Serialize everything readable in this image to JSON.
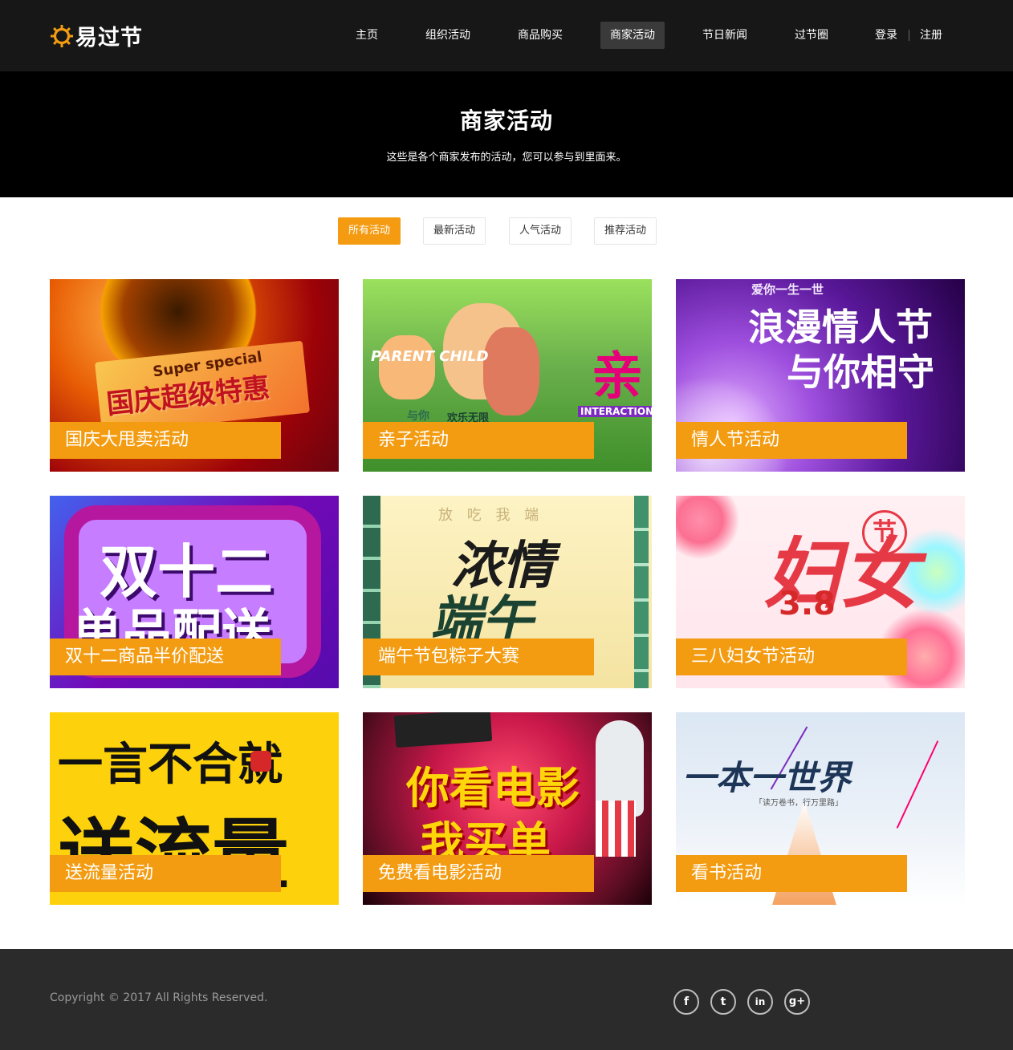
{
  "brand": {
    "name": "易过节",
    "accent": "#f39c12"
  },
  "nav": {
    "items": [
      "主页",
      "组织活动",
      "商品购买",
      "商家活动",
      "节日新闻",
      "过节圈"
    ],
    "active_index": 3,
    "login": "登录",
    "register": "注册"
  },
  "hero": {
    "title": "商家活动",
    "subtitle": "这些是各个商家发布的活动，您可以参与到里面来。"
  },
  "filters": {
    "items": [
      "所有活动",
      "最新活动",
      "人气活动",
      "推荐活动"
    ],
    "active_index": 0
  },
  "cards": [
    {
      "label": "国庆大甩卖活动",
      "art": [
        "Super special",
        "国庆超级特惠"
      ]
    },
    {
      "label": "亲子活动",
      "art": [
        "PARENT CHILD",
        "亲",
        "与你",
        "欢乐无限",
        "INTERACTION"
      ]
    },
    {
      "label": "情人节活动",
      "art": [
        "爱你一生一世",
        "浪漫情人节",
        "与你相守"
      ]
    },
    {
      "label": "双十二商品半价配送",
      "art": [
        "双十二",
        "单品配送"
      ]
    },
    {
      "label": "端午节包粽子大赛",
      "art": [
        "浓情",
        "端午",
        "放 吃 我 端"
      ]
    },
    {
      "label": "三八妇女节活动",
      "art": [
        "妇女",
        "节",
        "3.8"
      ]
    },
    {
      "label": "送流量活动",
      "art": [
        "一言不合就",
        "送流量"
      ]
    },
    {
      "label": "免费看电影活动",
      "art": [
        "你看电影",
        "我买单"
      ]
    },
    {
      "label": "看书活动",
      "art": [
        "一本一世界",
        "「读万卷书，行万里路」"
      ]
    }
  ],
  "footer": {
    "copyright": "Copyright © 2017 All Rights Reserved.",
    "social": [
      {
        "icon": "facebook-icon",
        "glyph": "f"
      },
      {
        "icon": "twitter-icon",
        "glyph": "t"
      },
      {
        "icon": "linkedin-icon",
        "glyph": "in"
      },
      {
        "icon": "google-plus-icon",
        "glyph": "g+"
      }
    ]
  }
}
